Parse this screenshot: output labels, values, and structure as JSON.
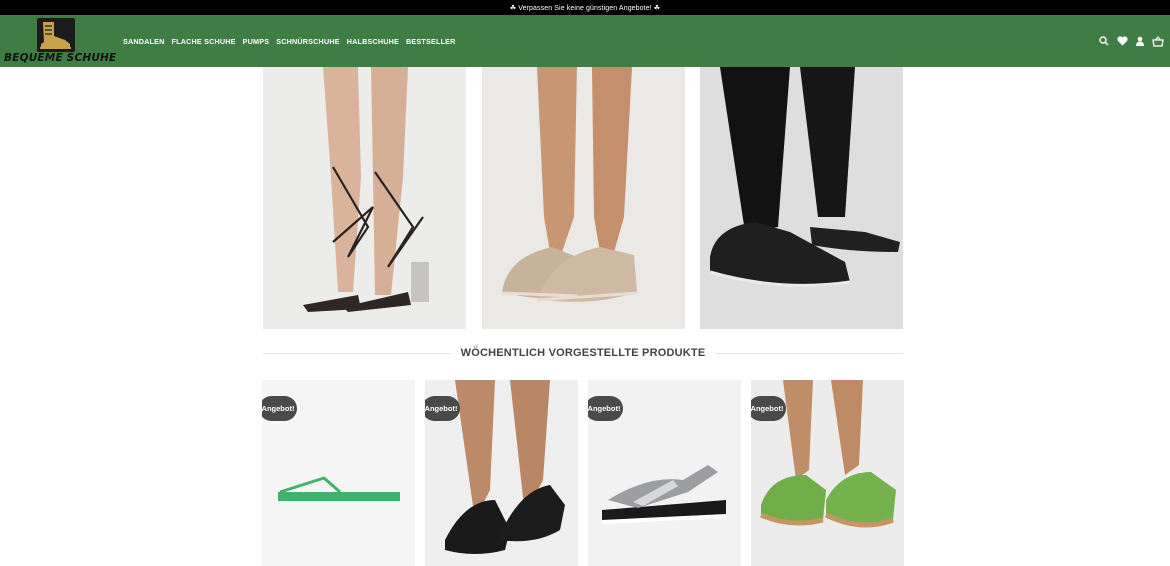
{
  "promo": {
    "text": "☘ Verpassen Sie keine günstigen Angebote! ☘"
  },
  "brand": {
    "name": "BEQUEME SCHUHE"
  },
  "nav": {
    "items": [
      "SANDALEN",
      "FLACHE SCHUHE",
      "PUMPS",
      "SCHNÜRSCHUHE",
      "HALBSCHUHE",
      "BESTSELLER"
    ]
  },
  "header_icons": [
    "search-icon",
    "heart-icon",
    "user-icon",
    "basket-icon"
  ],
  "section": {
    "title": "WÖCHENTLICH VORGESTELLTE PRODUKTE"
  },
  "products": [
    {
      "badge": "Angebot!"
    },
    {
      "badge": "Angebot!"
    },
    {
      "badge": "Angebot!"
    },
    {
      "badge": "Angebot!"
    }
  ],
  "colors": {
    "header": "#3f7d45",
    "topbar": "#000000",
    "badge": "#4a4a4a"
  }
}
